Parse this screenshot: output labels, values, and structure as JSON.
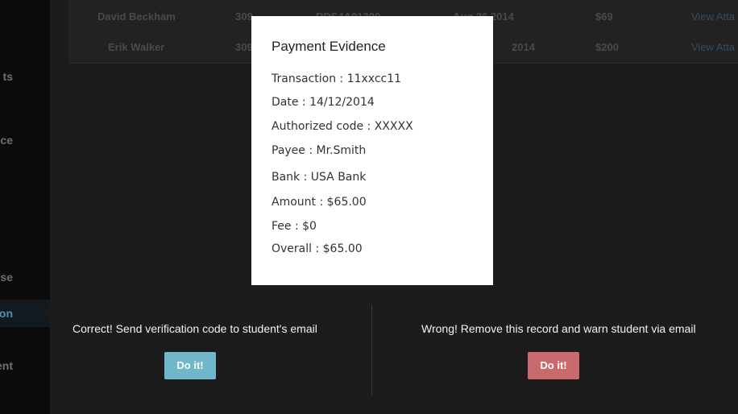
{
  "sidebar": {
    "items": [
      {
        "label": "ts"
      },
      {
        "label": "nce"
      },
      {
        "label": "ourse"
      },
      {
        "label": "on"
      },
      {
        "label": "ayment"
      }
    ]
  },
  "table": {
    "rows": [
      {
        "name": "David Beckham",
        "col2": "309",
        "col3": "RDS4A91300",
        "date": "Aug 26 2014",
        "amount": "$69",
        "link": "View Atta"
      },
      {
        "name": "Erik Walker",
        "col2": "309",
        "col3": "",
        "date": "2014",
        "amount": "$200",
        "link": "View Atta"
      }
    ]
  },
  "modal": {
    "title": "Payment Evidence",
    "fields": [
      "Transaction : 11xxcc11",
      "Date : 14/12/2014",
      "Authorized code : XXXXX",
      "Payee : Mr.Smith",
      "Bank : USA Bank",
      "Amount : $65.00",
      "Fee : $0",
      "Overall : $65.00"
    ]
  },
  "actions": {
    "correct": {
      "text": "Correct! Send verification code to student's email",
      "button": "Do it!",
      "color": "#6fb7c9"
    },
    "wrong": {
      "text": "Wrong! Remove this record and warn student via email",
      "button": "Do it!",
      "color": "#c96a6c"
    }
  }
}
